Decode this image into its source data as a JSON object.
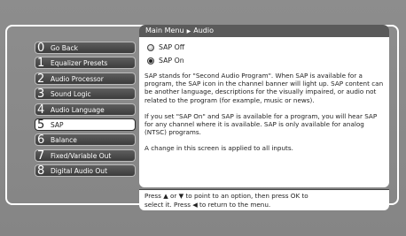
{
  "breadcrumb": {
    "parent": "Main Menu",
    "separator": "▶",
    "current": "Audio"
  },
  "menu": {
    "items": [
      {
        "num": "0",
        "label": "Go Back",
        "active": false
      },
      {
        "num": "1",
        "label": "Equalizer Presets",
        "active": false
      },
      {
        "num": "2",
        "label": "Audio Processor",
        "active": false
      },
      {
        "num": "3",
        "label": "Sound Logic",
        "active": false
      },
      {
        "num": "4",
        "label": "Audio Language",
        "active": false
      },
      {
        "num": "5",
        "label": "SAP",
        "active": true
      },
      {
        "num": "6",
        "label": "Balance",
        "active": false
      },
      {
        "num": "7",
        "label": "Fixed/Variable Out",
        "active": false
      },
      {
        "num": "8",
        "label": "Digital Audio Out",
        "active": false
      }
    ]
  },
  "options": [
    {
      "label": "SAP Off",
      "selected": false
    },
    {
      "label": "SAP On",
      "selected": true
    }
  ],
  "description": {
    "p1": "SAP stands for \"Second Audio Program\". When SAP is available for a program, the SAP icon in the channel banner will light up. SAP content can be another language, descriptions for the visually impaired, or audio not related to the program (for example, music or news).",
    "p2": "If you set \"SAP On\" and SAP is available for a program, you will hear SAP for any channel where it is available. SAP is only available for analog (NTSC) programs.",
    "p3": "A change in this screen is applied to all inputs."
  },
  "help": {
    "line1": "Press ▲ or ▼ to point to an option, then press OK to",
    "line2": "select it. Press ◀ to return to the menu."
  }
}
